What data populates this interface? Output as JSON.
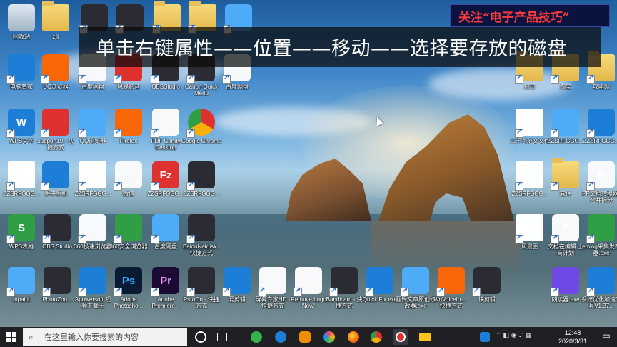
{
  "banner": {
    "instruction": "单击右键属性——位置——移动——选择要存放的磁盘"
  },
  "top_note": {
    "text": "关注“电子产品技巧”"
  },
  "taskbar": {
    "search_placeholder": "在这里输入你要搜索的内容",
    "time": "12:48",
    "date": "2020/3/31"
  },
  "desktop": {
    "icons": [
      {
        "label": "回收站",
        "icon": "recycle-bin-icon",
        "style": "bin"
      },
      {
        "label": "zjli",
        "icon": "folder-icon",
        "style": "folder"
      },
      {
        "label": "",
        "icon": "app-icon",
        "style": "dark"
      },
      {
        "label": "",
        "icon": "app-icon",
        "style": "dark"
      },
      {
        "label": "",
        "icon": "folder-icon",
        "style": "folder"
      },
      {
        "label": "",
        "icon": "folder-icon",
        "style": "folder"
      },
      {
        "label": "",
        "icon": "search-app-icon",
        "style": "lightblue"
      },
      {
        "label": "电脑管家",
        "icon": "shield-icon",
        "style": "blue"
      },
      {
        "label": "UC浏览器",
        "icon": "uc-browser-icon",
        "style": "orange"
      },
      {
        "label": "百度网盘",
        "icon": "cloud-icon",
        "style": "white"
      },
      {
        "label": "风暴影音",
        "icon": "media-icon",
        "style": "red"
      },
      {
        "label": "OBSStudio",
        "icon": "obs-icon",
        "style": "dark"
      },
      {
        "label": "Canon Quick Menu",
        "icon": "canon-icon",
        "style": "dark"
      },
      {
        "label": "百度网盘",
        "icon": "baidu-netdisk-icon",
        "style": "white"
      },
      {
        "label": "打印",
        "icon": "folder-icon",
        "style": "folder"
      },
      {
        "label": "淘宝",
        "icon": "folder-icon",
        "style": "folder"
      },
      {
        "label": "攻略网",
        "icon": "folder-icon",
        "style": "folder"
      },
      {
        "label": "WPS文字",
        "icon": "wps-word-icon",
        "style": "blue"
      },
      {
        "label": "support19 - 快捷方式",
        "icon": "netease-icon",
        "style": "red"
      },
      {
        "label": "QQ浏览器",
        "icon": "qq-browser-icon",
        "style": "lightblue"
      },
      {
        "label": "Firefox",
        "icon": "firefox-icon",
        "style": "orange"
      },
      {
        "label": "PDF Candy Desktop",
        "icon": "pdf-candy-icon",
        "style": "white"
      },
      {
        "label": "Google Chrome",
        "icon": "chrome-icon",
        "style": "chrome"
      },
      {
        "label": "三千字范文文件",
        "icon": "document-icon",
        "style": "doc"
      },
      {
        "label": "ZZSRFGGG...",
        "icon": "app-icon",
        "style": "lightblue"
      },
      {
        "label": "ZZSRFGGG...",
        "icon": "mic-icon",
        "style": "blue"
      },
      {
        "label": "ZZSRFGGG...",
        "icon": "document-icon",
        "style": "doc"
      },
      {
        "label": "手牛手机",
        "icon": "app-icon",
        "style": "blue"
      },
      {
        "label": "ZZSRFGGG...",
        "icon": "document-icon",
        "style": "doc"
      },
      {
        "label": "微信",
        "icon": "wechat-icon",
        "style": "white"
      },
      {
        "label": "ZZSRFGGG...",
        "icon": "filezilla-icon",
        "style": "red"
      },
      {
        "label": "ZZSRFGGG...",
        "icon": "app-icon",
        "style": "dark"
      },
      {
        "label": "ZZSRFGGG...",
        "icon": "document-icon",
        "style": "doc"
      },
      {
        "label": "软件",
        "icon": "folder-icon",
        "style": "folder"
      },
      {
        "label": "PP文档转换器-合并拆分",
        "icon": "pdf-icon",
        "style": "white"
      },
      {
        "label": "WPS表格",
        "icon": "wps-sheet-icon",
        "style": "green"
      },
      {
        "label": "OBS Studio",
        "icon": "obs-icon",
        "style": "dark"
      },
      {
        "label": "360极速浏览器",
        "icon": "360-icon",
        "style": "white"
      },
      {
        "label": "360安全浏览器",
        "icon": "ie-icon",
        "style": "green"
      },
      {
        "label": "百度网盘",
        "icon": "cloud-icon",
        "style": "lightblue"
      },
      {
        "label": "BaiduNetdisk - 快捷方式",
        "icon": "app-icon",
        "style": "dark"
      },
      {
        "label": "风景图",
        "icon": "document-icon",
        "style": "doc"
      },
      {
        "label": "文档在编辑 上商计划",
        "icon": "pdf-icon",
        "style": "white"
      },
      {
        "label": "emlog采集发布器.exe",
        "icon": "chat-icon",
        "style": "green"
      },
      {
        "label": "Inpaint",
        "icon": "inpaint-icon",
        "style": "lightblue"
      },
      {
        "label": "PhotoZoo...",
        "icon": "photozoom-icon",
        "style": "dark"
      },
      {
        "label": "Apowersoft 视频下载王",
        "icon": "apowersoft-icon",
        "style": "blue"
      },
      {
        "label": "Adobe Photosho...",
        "icon": "photoshop-icon",
        "style": "ps"
      },
      {
        "label": "Adobe Premiere...",
        "icon": "premiere-icon",
        "style": "pr"
      },
      {
        "label": "PsroOn - 快捷方式",
        "icon": "pen-icon",
        "style": "dark"
      },
      {
        "label": "爱剪辑",
        "icon": "app-icon",
        "style": "blue"
      },
      {
        "label": "屏幕专家HD - 快捷方式",
        "icon": "screen-icon",
        "style": "white"
      },
      {
        "label": "Remove Logo Now!",
        "icon": "remove-logo-icon",
        "style": "white"
      },
      {
        "label": "Bandicam - 快捷方式",
        "icon": "bandicam-icon",
        "style": "dark"
      },
      {
        "label": "Quick Fix.exe",
        "icon": "quickfix-icon",
        "style": "blue"
      },
      {
        "label": "翻译文章原创修改器.exe",
        "icon": "magnifier-icon",
        "style": "lightblue"
      },
      {
        "label": "WnVoiceIn... - 快捷方式",
        "icon": "voice-icon",
        "style": "orange"
      },
      {
        "label": "快剪辑",
        "icon": "kuaijianji-icon",
        "style": "dark"
      },
      {
        "label": "朗读器.exe",
        "icon": "mic-icon",
        "style": "purple"
      },
      {
        "label": "系统优化加速工具V1.37...",
        "icon": "tools-icon",
        "style": "blue"
      }
    ]
  },
  "colors": {
    "taskbar": "#1f1f24",
    "banner_bg": "#0a0a0a",
    "note_text": "#ff3b3b",
    "note_bg": "#0a1240"
  }
}
